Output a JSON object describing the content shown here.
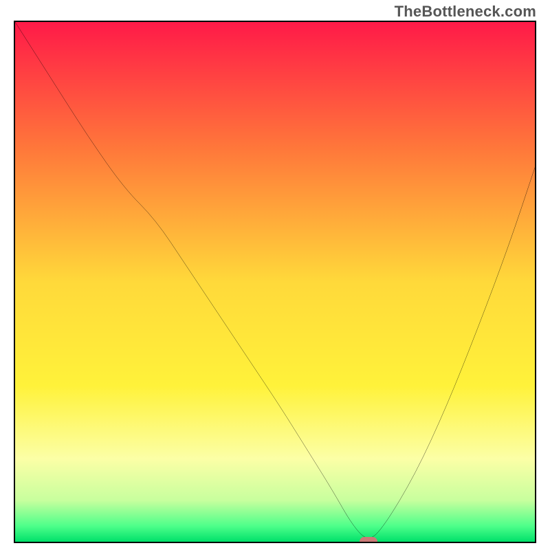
{
  "watermark": {
    "text": "TheBottleneck.com"
  },
  "chart_data": {
    "type": "line",
    "title": "",
    "xlabel": "",
    "ylabel": "",
    "xlim": [
      0,
      100
    ],
    "ylim": [
      0,
      100
    ],
    "grid": false,
    "legend": false,
    "gradient_stops": [
      {
        "offset": 0,
        "color": "#ff1a48"
      },
      {
        "offset": 25,
        "color": "#ff7a3a"
      },
      {
        "offset": 50,
        "color": "#ffd93a"
      },
      {
        "offset": 70,
        "color": "#fff23a"
      },
      {
        "offset": 84,
        "color": "#fcffa6"
      },
      {
        "offset": 92,
        "color": "#c8ff9e"
      },
      {
        "offset": 97,
        "color": "#4dff8a"
      },
      {
        "offset": 100,
        "color": "#00e06a"
      }
    ],
    "series": [
      {
        "name": "bottleneck-curve",
        "x": [
          0,
          7,
          14,
          21,
          27,
          33,
          39,
          45,
          51,
          56,
          61,
          65,
          68,
          71,
          77,
          83,
          89,
          95,
          100
        ],
        "values": [
          100,
          89,
          78,
          68,
          62,
          53,
          44,
          35,
          26,
          18,
          10,
          3,
          0,
          3,
          13,
          26,
          41,
          57,
          72
        ]
      }
    ],
    "marker": {
      "x": 68,
      "y": 0,
      "color": "#cb7a77"
    }
  }
}
